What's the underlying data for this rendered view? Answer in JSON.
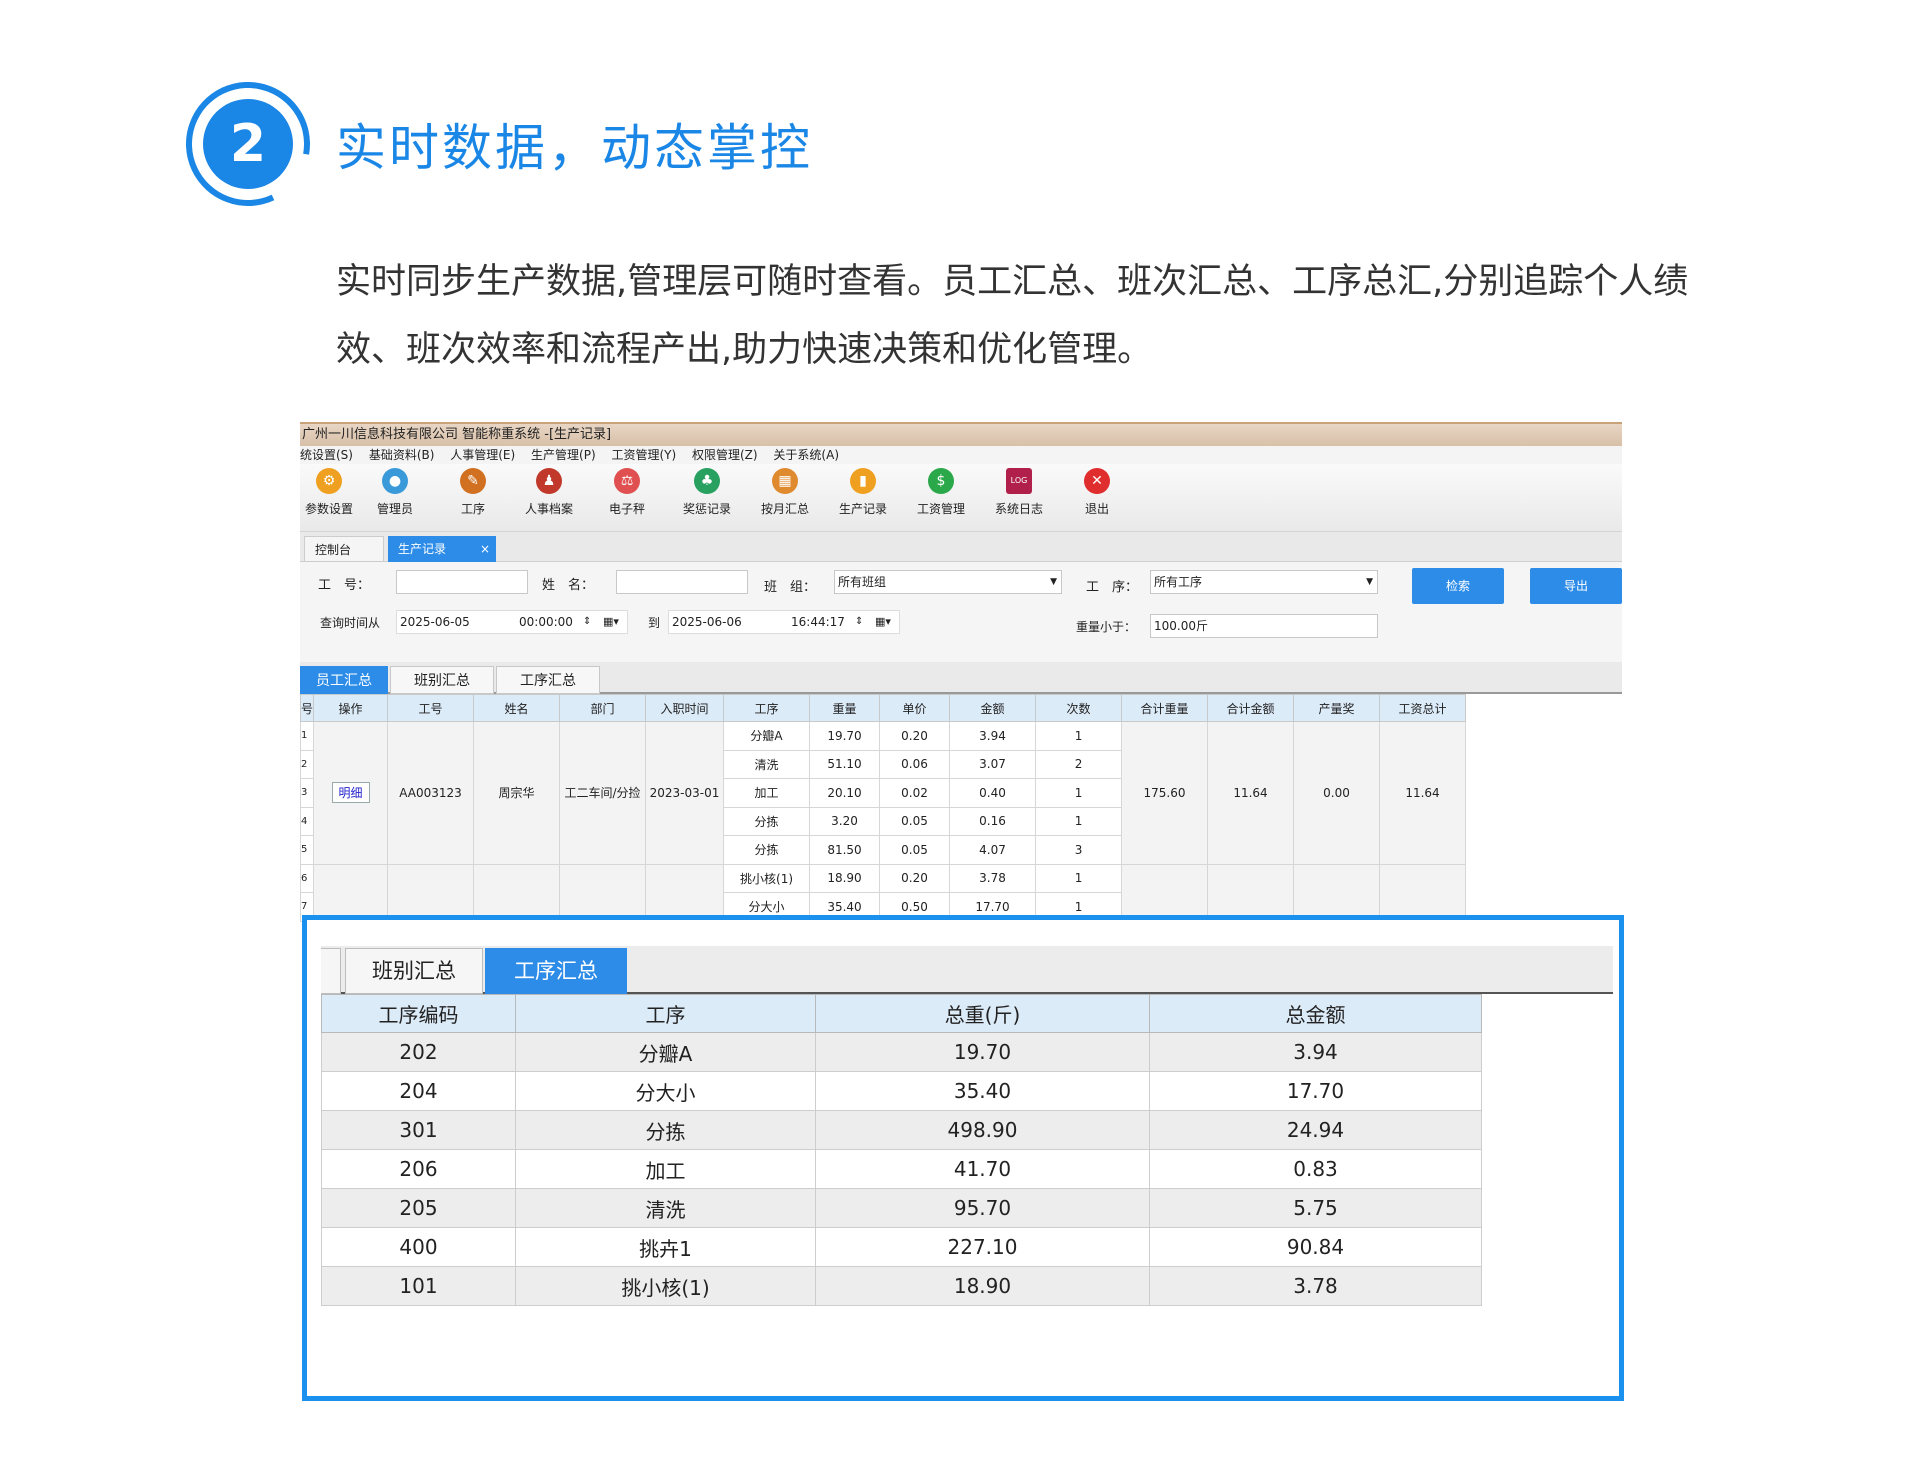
{
  "heading": {
    "number": "2",
    "title": "实时数据，动态掌控",
    "description": "实时同步生产数据,管理层可随时查看。员工汇总、班次汇总、工序总汇,分别追踪个人绩效、班次效率和流程产出,助力快速决策和优化管理。",
    "accent": "#1a86e6"
  },
  "app": {
    "window_title": "广州一川信息科技有限公司 智能称重系统 -[生产记录]",
    "menu": [
      "统设置(S)",
      "基础资料(B)",
      "人事管理(E)",
      "生产管理(P)",
      "工资管理(Y)",
      "权限管理(Z)",
      "关于系统(A)"
    ],
    "toolbar": [
      {
        "label": "参数设置",
        "icon": "gear-icon",
        "glyph": "⚙",
        "color": "#f0a020"
      },
      {
        "label": "管理员",
        "icon": "user-icon",
        "glyph": "●",
        "color": "#3a9ad9"
      },
      {
        "label": "工序",
        "icon": "tools-icon",
        "glyph": "✎",
        "color": "#d07020"
      },
      {
        "label": "人事档案",
        "icon": "people-icon",
        "glyph": "♟",
        "color": "#c0392b"
      },
      {
        "label": "电子秤",
        "icon": "scale-icon",
        "glyph": "⚖",
        "color": "#e05050"
      },
      {
        "label": "奖惩记录",
        "icon": "team-icon",
        "glyph": "♣",
        "color": "#27a060"
      },
      {
        "label": "按月汇总",
        "icon": "calendar-icon",
        "glyph": "▦",
        "color": "#e08a30"
      },
      {
        "label": "生产记录",
        "icon": "chart-icon",
        "glyph": "▮",
        "color": "#f0a020"
      },
      {
        "label": "工资管理",
        "icon": "dollar-icon",
        "glyph": "$",
        "color": "#2aa84a"
      },
      {
        "label": "系统日志",
        "icon": "log-icon",
        "glyph": "LOG",
        "color": "#b0204a"
      },
      {
        "label": "退出",
        "icon": "close-icon",
        "glyph": "✕",
        "color": "#e02d2d"
      }
    ],
    "doc_tabs": {
      "console": "控制台",
      "production": "生产记录",
      "close": "×"
    },
    "filter": {
      "emp_id_label": "工　号：",
      "emp_id_value": "",
      "name_label": "姓　名：",
      "name_value": "",
      "group_label": "班　组：",
      "group_value": "所有班组",
      "process_label": "工　序：",
      "process_value": "所有工序",
      "search_btn": "检索",
      "export_btn": "导出",
      "from_label": "查询时间从",
      "from_date": "2025-06-05",
      "from_time": "00:00:00",
      "to_label": "到",
      "to_date": "2025-06-06",
      "to_time": "16:44:17",
      "weight_label": "重量小于：",
      "weight_value": "100.00斤"
    },
    "sub_tabs": [
      "员工汇总",
      "班别汇总",
      "工序汇总"
    ],
    "grid": {
      "headers": [
        "号",
        "操作",
        "工号",
        "姓名",
        "部门",
        "入职时间",
        "工序",
        "重量",
        "单价",
        "金额",
        "次数",
        "合计重量",
        "合计金额",
        "产量奖",
        "工资总计"
      ],
      "row_nums": [
        "1",
        "2",
        "3",
        "4",
        "5",
        "6",
        "7"
      ],
      "detail_btn": "明细",
      "emp_id": "AA003123",
      "emp_name": "周宗华",
      "dept": "工二车间/分捡",
      "join_date": "2023-03-01",
      "lines": [
        [
          "分瓣A",
          "19.70",
          "0.20",
          "3.94",
          "1"
        ],
        [
          "清洗",
          "51.10",
          "0.06",
          "3.07",
          "2"
        ],
        [
          "加工",
          "20.10",
          "0.02",
          "0.40",
          "1"
        ],
        [
          "分拣",
          "3.20",
          "0.05",
          "0.16",
          "1"
        ],
        [
          "分拣",
          "81.50",
          "0.05",
          "4.07",
          "3"
        ],
        [
          "挑小核(1)",
          "18.90",
          "0.20",
          "3.78",
          "1"
        ],
        [
          "分大小",
          "35.40",
          "0.50",
          "17.70",
          "1"
        ]
      ],
      "total_weight": "175.60",
      "total_amount": "11.64",
      "output_bonus": "0.00",
      "wage_total": "11.64"
    }
  },
  "zoom": {
    "tabs": [
      "班别汇总",
      "工序汇总"
    ],
    "headers": [
      "工序编码",
      "工序",
      "总重(斤)",
      "总金额"
    ],
    "rows": [
      [
        "202",
        "分瓣A",
        "19.70",
        "3.94"
      ],
      [
        "204",
        "分大小",
        "35.40",
        "17.70"
      ],
      [
        "301",
        "分拣",
        "498.90",
        "24.94"
      ],
      [
        "206",
        "加工",
        "41.70",
        "0.83"
      ],
      [
        "205",
        "清洗",
        "95.70",
        "5.75"
      ],
      [
        "400",
        "挑卉1",
        "227.10",
        "90.84"
      ],
      [
        "101",
        "挑小核(1)",
        "18.90",
        "3.78"
      ]
    ]
  }
}
